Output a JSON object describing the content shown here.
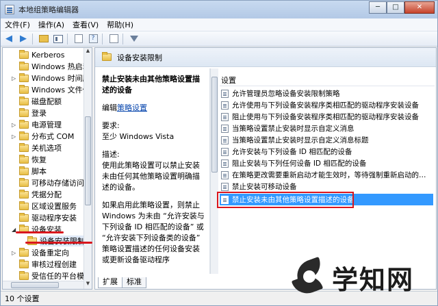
{
  "window": {
    "title": "本地组策略编辑器"
  },
  "menu": [
    "文件(F)",
    "操作(A)",
    "查看(V)",
    "帮助(H)"
  ],
  "window_buttons": {
    "minimize": "─",
    "maximize": "□",
    "close": "✕"
  },
  "tree": {
    "items": [
      {
        "label": "Kerberos",
        "expander": ""
      },
      {
        "label": "Windows 热启动",
        "expander": ""
      },
      {
        "label": "Windows 时间服",
        "expander": "▷"
      },
      {
        "label": "Windows 文件保",
        "expander": ""
      },
      {
        "label": "磁盘配额",
        "expander": ""
      },
      {
        "label": "登录",
        "expander": ""
      },
      {
        "label": "电源管理",
        "expander": "▷"
      },
      {
        "label": "分布式 COM",
        "expander": "▷"
      },
      {
        "label": "关机选项",
        "expander": ""
      },
      {
        "label": "恢复",
        "expander": ""
      },
      {
        "label": "脚本",
        "expander": ""
      },
      {
        "label": "可移动存储访问",
        "expander": ""
      },
      {
        "label": "凭据分配",
        "expander": ""
      },
      {
        "label": "区域设置服务",
        "expander": ""
      },
      {
        "label": "驱动程序安装",
        "expander": ""
      },
      {
        "label": "设备安装",
        "expander": "◢"
      },
      {
        "label": "设备安装限制",
        "expander": "",
        "child": true
      },
      {
        "label": "设备重定向",
        "expander": "▷"
      },
      {
        "label": "审核过程创建",
        "expander": ""
      },
      {
        "label": "受信任的平台模块",
        "expander": ""
      }
    ]
  },
  "content": {
    "header": "设备安装限制",
    "description": {
      "policy_title": "禁止安装未由其他策略设置描述的设备",
      "edit_prefix": "编辑",
      "edit_link": "策略设置",
      "req_label": "要求:",
      "req_value": "至少 Windows Vista",
      "desc_label": "描述:",
      "desc_text": "使用此策略设置可以禁止安装未由任何其他策略设置明确描述的设备。",
      "more_text": "如果启用此策略设置，则禁止 Windows 为未由 “允许安装与下列设备 ID 相匹配的设备” 或 “允许安装下列设备类的设备” 策略设置描述的任何设备安装或更新设备驱动程序"
    },
    "list_header": "设置",
    "policies": [
      "允许管理员忽略设备安装限制策略",
      "允许使用与下列设备安装程序类相匹配的驱动程序安装设备",
      "阻止使用与下列设备安装程序类相匹配的驱动程序安装设备",
      "当策略设置禁止安装时显示自定义消息",
      "当策略设置禁止安装时显示自定义消息标题",
      "允许安装与下列设备 ID 相匹配的设备",
      "阻止安装与下列任何设备 ID 相匹配的设备",
      "在策略更改需要重新启动才能生效时，等待强制重新启动的…",
      "禁止安装可移动设备",
      "禁止安装未由其他策略设置描述的设备"
    ],
    "tabs": [
      "扩展",
      "标准"
    ]
  },
  "status": {
    "text": "10 个设置"
  },
  "watermark": {
    "text": "学知网"
  },
  "colors": {
    "selection": "#3399ff",
    "annotation": "#d9161d"
  }
}
